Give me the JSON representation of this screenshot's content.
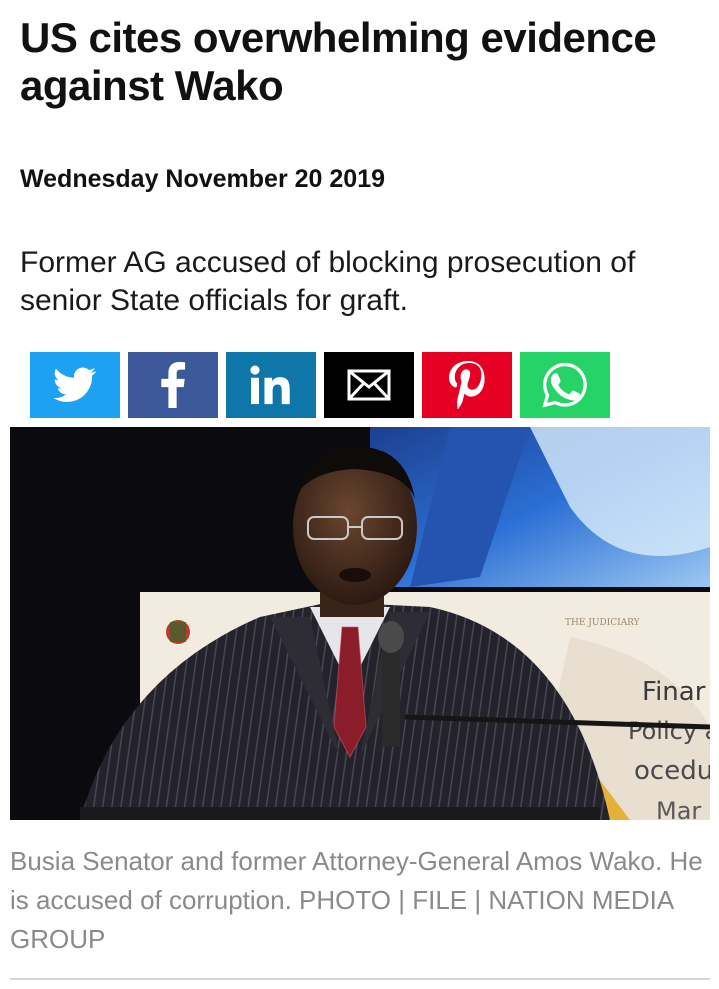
{
  "article": {
    "headline": "US cites overwhelming evidence against Wako",
    "date": "Wednesday November 20 2019",
    "summary": "Former AG accused of blocking prosecution of senior State officials for graft.",
    "caption": "Busia Senator and former Attorney-General Amos Wako. He is accused of corruption. PHOTO | FILE | NATION MEDIA GROUP"
  },
  "share_buttons": [
    {
      "network": "Twitter",
      "icon": "twitter-bird-icon",
      "color": "#1da1f2"
    },
    {
      "network": "Facebook",
      "icon": "facebook-f-icon",
      "color": "#3b5998"
    },
    {
      "network": "LinkedIn",
      "icon": "linkedin-in-icon",
      "color": "#0e76a8"
    },
    {
      "network": "Email",
      "icon": "envelope-icon",
      "color": "#000000"
    },
    {
      "network": "Pinterest",
      "icon": "pinterest-p-icon",
      "color": "#e60023"
    },
    {
      "network": "WhatsApp",
      "icon": "whatsapp-icon",
      "color": "#25d366"
    }
  ],
  "photo": {
    "backdrop_text": {
      "institution": "THE JUDICIARY",
      "line1": "Finar",
      "line2": "Policy a",
      "line3": "oceduı",
      "line4": "Mar"
    }
  }
}
